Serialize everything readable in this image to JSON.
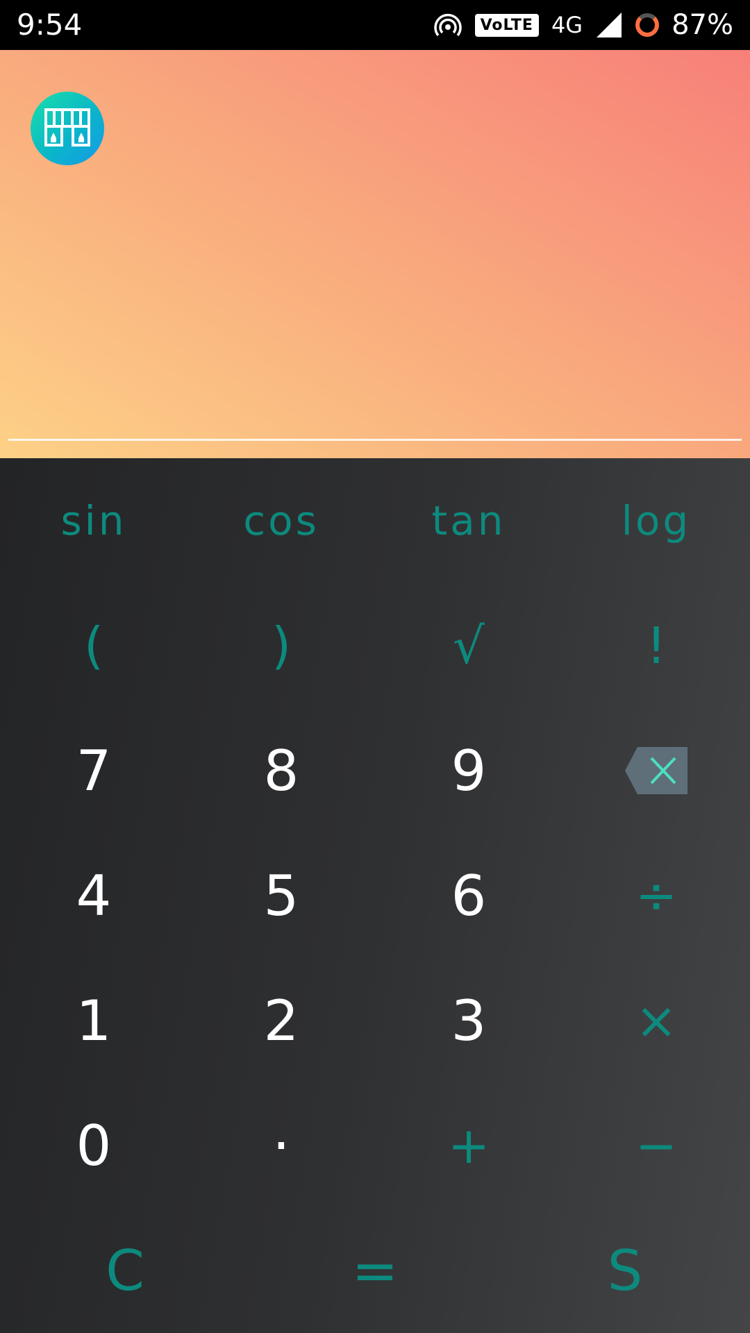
{
  "status_bar": {
    "time": "9:54",
    "volte": "VoLTE",
    "network": "4G",
    "battery": "87%"
  },
  "display": {
    "expression": "",
    "app_icon": "store-icon"
  },
  "keypad": {
    "row1": [
      "sin",
      "cos",
      "tan",
      "log"
    ],
    "row2": [
      "(",
      ")",
      "√",
      "!"
    ],
    "row3": [
      "7",
      "8",
      "9"
    ],
    "row4": [
      "4",
      "5",
      "6",
      "÷"
    ],
    "row5": [
      "1",
      "2",
      "3",
      "×"
    ],
    "row6": [
      "0",
      "·",
      "+",
      "−"
    ],
    "bottom": [
      "C",
      "=",
      "S"
    ],
    "backspace_icon": "backspace-icon"
  },
  "colors": {
    "accent": "#0d8a7e",
    "gradient_start": "#fdd187",
    "gradient_end": "#f78079",
    "keypad_bg": "#2b2c2e"
  }
}
